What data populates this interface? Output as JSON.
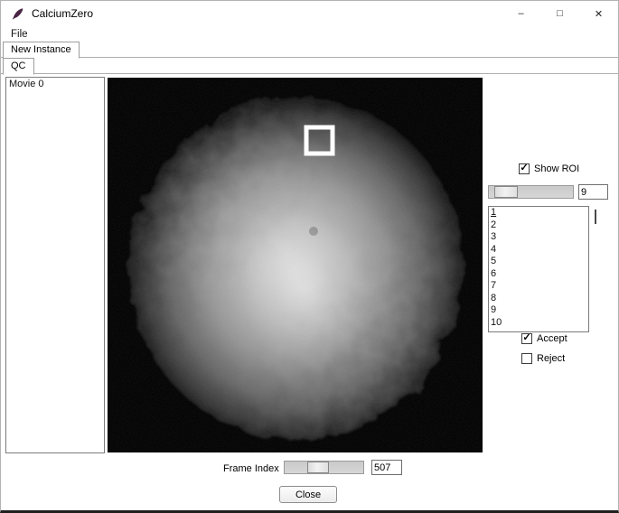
{
  "titlebar": {
    "title": "CalciumZero",
    "minimize": "–",
    "maximize": "□",
    "close": "✕"
  },
  "menu": {
    "file": "File"
  },
  "tabs": {
    "new_instance": "New Instance",
    "qc": "QC"
  },
  "movies": {
    "items": [
      "Movie 0"
    ]
  },
  "roi": {
    "show_roi_label": "Show ROI",
    "show_roi_checked": true,
    "slider_value": "9",
    "list_items": [
      "1",
      "2",
      "3",
      "4",
      "5",
      "6",
      "7",
      "8",
      "9",
      "10"
    ],
    "accept_label": "Accept",
    "accept_checked": true,
    "reject_label": "Reject",
    "reject_checked": false
  },
  "frame": {
    "label": "Frame Index",
    "value": "507"
  },
  "actions": {
    "close": "Close"
  },
  "glyphs": {
    "check": "✓"
  },
  "colors": {
    "roi_outline": "#ffffff",
    "image_background": "#000000"
  }
}
